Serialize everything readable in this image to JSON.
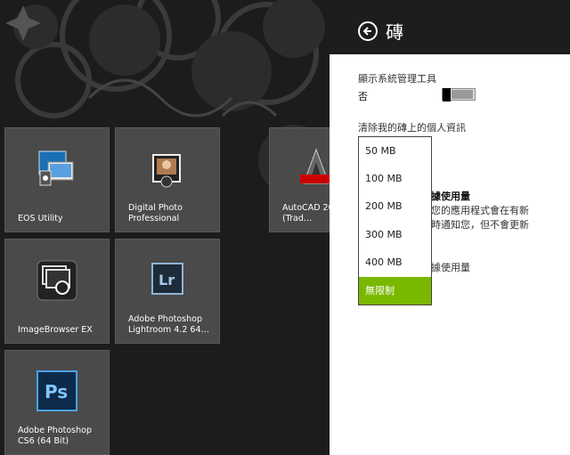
{
  "tiles": [
    {
      "label": "EOS Utility",
      "icon": "eos-utility-icon"
    },
    {
      "label": "Digital Photo Professional",
      "icon": "digital-photo-professional-icon"
    },
    {
      "label": "AutoCAD 20… 體中文 (Trad…",
      "icon": "autocad-icon"
    },
    {
      "label": "ImageBrowser EX",
      "icon": "imagebrowser-icon"
    },
    {
      "label": "Adobe Photoshop Lightroom 4.2 64…",
      "icon": "lightroom-icon"
    },
    {
      "label": "Adobe Photoshop CS6 (64 Bit)",
      "icon": "photoshop-icon"
    }
  ],
  "pane": {
    "title": "磚",
    "show_admin_tools_label": "顯示系統管理工具",
    "show_admin_tools_value": "否",
    "clear_info_label": "清除我的磚上的個人資訊",
    "behind_bold_1": "據使用量",
    "behind_line_1": "您的應用程式會在有新",
    "behind_line_2": "時通知您，但不會更新",
    "behind_bold_2": "據使用量"
  },
  "dropdown": {
    "options": [
      "50 MB",
      "100 MB",
      "200 MB",
      "300 MB",
      "400 MB",
      "無限制"
    ],
    "selected_index": 5
  },
  "colors": {
    "accent": "#7ab800",
    "pane_header": "#1d1d1d",
    "tile": "#4a4a4a"
  }
}
